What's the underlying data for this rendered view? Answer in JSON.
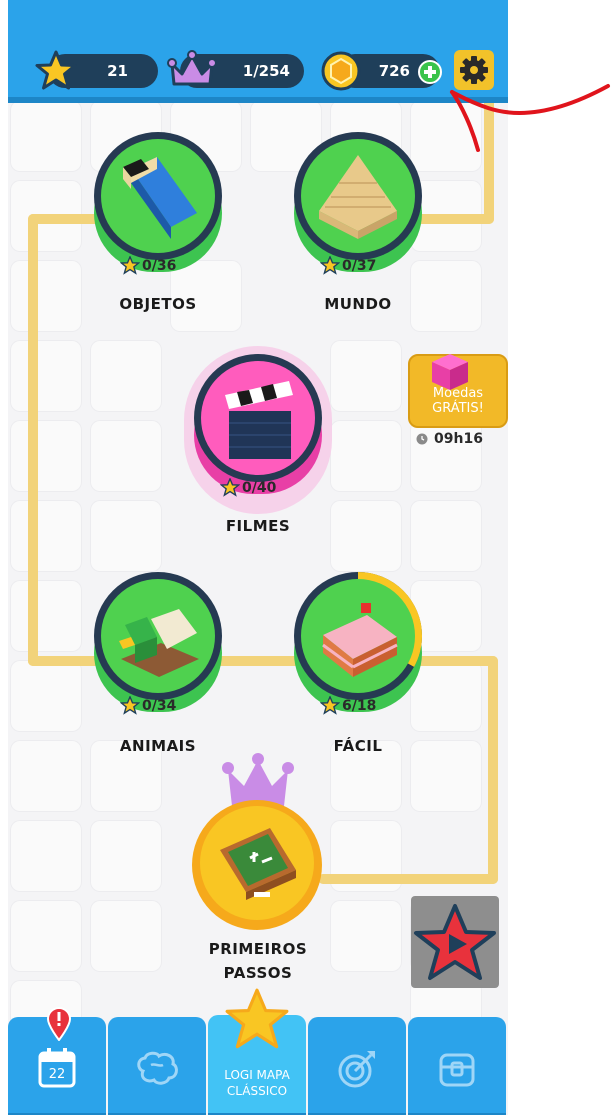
{
  "top_bar": {
    "stars_count": "21",
    "crowns_count": "1/254",
    "coins_count": "726"
  },
  "levels": [
    {
      "name": "OBJETOS",
      "stars": "0/36"
    },
    {
      "name": "MUNDO",
      "stars": "0/37"
    },
    {
      "name": "FILMES",
      "stars": "0/40"
    },
    {
      "name": "ANIMAIS",
      "stars": "0/34"
    },
    {
      "name": "FÁCIL",
      "stars": "6/18"
    }
  ],
  "start_level": {
    "name_line1": "PRIMEIROS",
    "name_line2": "PASSOS"
  },
  "free_coins": {
    "label_line1": "Moedas",
    "label_line2": "GRÁTIS!",
    "timer": "09h16"
  },
  "bottom_nav": {
    "calendar_day": "22",
    "map_label_line1": "LOGI MAPA",
    "map_label_line2": "CLÁSSICO"
  },
  "fill_level": {
    "facil_progress": 0.33
  },
  "colors": {
    "topbar": "#2ba3ea",
    "path": "#f2d37a",
    "green": "#3dc450",
    "pink": "#e83fa6",
    "annotation": "#e0141c"
  }
}
